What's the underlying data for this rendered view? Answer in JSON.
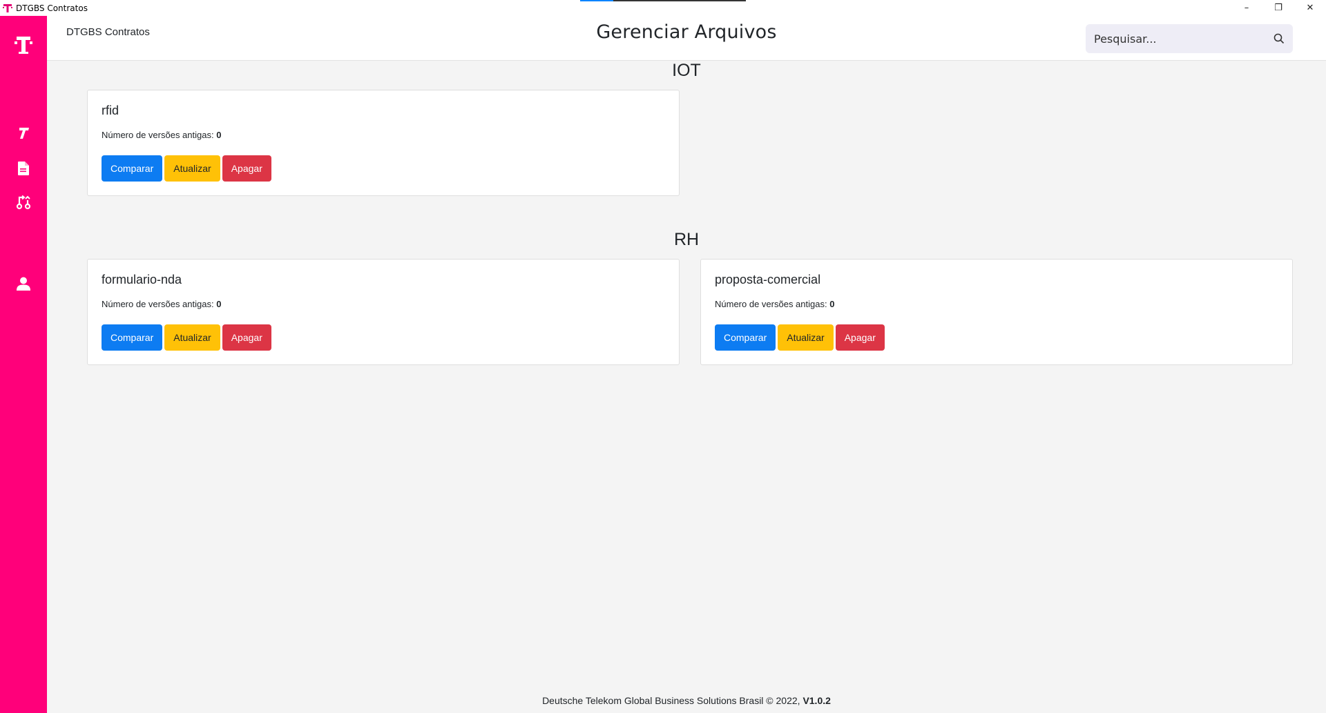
{
  "window": {
    "title": "DTGBS Contratos",
    "controls": {
      "minimize": "–",
      "maximize": "❐",
      "close": "✕"
    }
  },
  "header": {
    "brand": "DTGBS Contratos",
    "title": "Gerenciar Arquivos",
    "search_placeholder": "Pesquisar..."
  },
  "sidebar": {
    "items": [
      {
        "icon": "telekom-logo-icon"
      },
      {
        "icon": "templates-icon"
      },
      {
        "icon": "file-icon"
      },
      {
        "icon": "compare-icon"
      },
      {
        "icon": "user-icon"
      }
    ]
  },
  "labels": {
    "versions_label": "Número de versões antigas: ",
    "compare": "Comparar",
    "update": "Atualizar",
    "delete": "Apagar"
  },
  "sections": [
    {
      "title": "IOT",
      "files": [
        {
          "name": "rfid",
          "old_versions": "0"
        }
      ]
    },
    {
      "title": "RH",
      "files": [
        {
          "name": "formulario-nda",
          "old_versions": "0"
        },
        {
          "name": "proposta-comercial",
          "old_versions": "0"
        }
      ]
    }
  ],
  "footer": {
    "text": "Deutsche Telekom Global Business Solutions Brasil © 2022, ",
    "version": "V1.0.2"
  },
  "colors": {
    "sidebar": "#ff007a",
    "primary": "#0d7cf2",
    "warning": "#ffc107",
    "danger": "#dc3545"
  }
}
